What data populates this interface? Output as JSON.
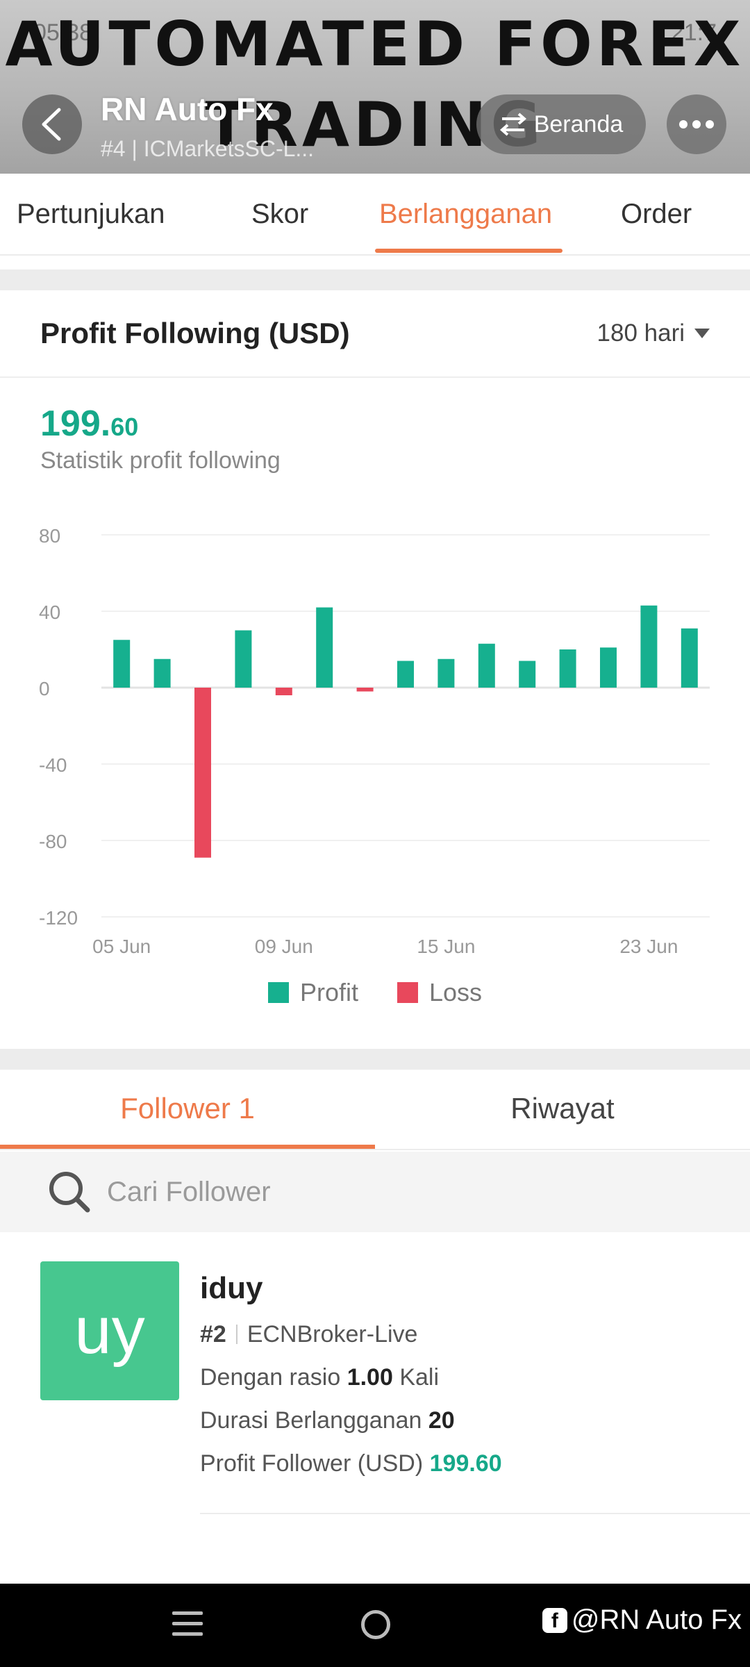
{
  "header": {
    "banner_line1": "AUTOMATED FOREX",
    "banner_line2": "TRADING",
    "status_time": "05.38",
    "status_right": "21:7",
    "title": "RN Auto Fx",
    "subtitle": "#4 | ICMarketsSC-L...",
    "beranda_label": "Beranda"
  },
  "tabs": [
    {
      "label": "Pertunjukan"
    },
    {
      "label": "Skor"
    },
    {
      "label": "Berlangganan",
      "active": true
    },
    {
      "label": "Order"
    }
  ],
  "card": {
    "title": "Profit Following (USD)",
    "period": "180 hari",
    "profit_int": "199.",
    "profit_dec": "60",
    "profit_label": "Statistik profit following"
  },
  "chart_data": {
    "type": "bar",
    "title": "",
    "xlabel": "",
    "ylabel": "",
    "ylim": [
      -120,
      80
    ],
    "yticks": [
      80,
      40,
      0,
      -40,
      -80,
      -120
    ],
    "x_tick_labels": [
      {
        "label": "05 Jun",
        "index": 0
      },
      {
        "label": "09 Jun",
        "index": 4
      },
      {
        "label": "15 Jun",
        "index": 8
      },
      {
        "label": "23 Jun",
        "index": 13
      }
    ],
    "values": [
      25,
      15,
      -89,
      30,
      -4,
      42,
      -2,
      14,
      15,
      23,
      14,
      20,
      21,
      43,
      31
    ],
    "colors": {
      "profit": "#16b08f",
      "loss": "#e8485c"
    },
    "legend": [
      {
        "label": "Profit",
        "color": "#16b08f"
      },
      {
        "label": "Loss",
        "color": "#e8485c"
      }
    ],
    "grid": true
  },
  "follower_tabs": [
    {
      "label": "Follower 1",
      "active": true
    },
    {
      "label": "Riwayat"
    }
  ],
  "search": {
    "placeholder": "Cari Follower"
  },
  "follower": {
    "avatar_text": "uy",
    "name": "iduy",
    "rank": "#2",
    "broker": "ECNBroker-Live",
    "ratio_prefix": "Dengan rasio",
    "ratio_value": "1.00",
    "ratio_suffix": "Kali",
    "duration_label": "Durasi Berlangganan",
    "duration_value": "20",
    "profit_label": "Profit Follower (USD)",
    "profit_value": "199.60"
  },
  "watermark": "@RN Auto Fx"
}
